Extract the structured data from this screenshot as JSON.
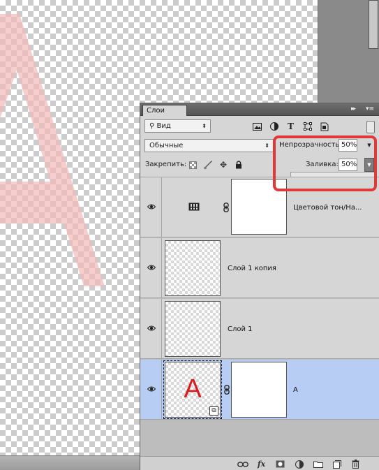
{
  "panel": {
    "tab_label": "Слои",
    "collapse_label": "▸▸",
    "menu_label": "▾≡"
  },
  "filter": {
    "kind_label": "Вид",
    "icons": [
      "image-filter-icon",
      "adjustment-filter-icon",
      "text-filter-icon",
      "shape-filter-icon",
      "smart-object-filter-icon"
    ],
    "text_filter_glyph": "T"
  },
  "blend": {
    "mode": "Обычные",
    "opacity_label": "Непрозрачность:",
    "opacity_value": "50%"
  },
  "lock": {
    "label": "Закрепить:",
    "icons": [
      "lock-transparent-pixels-icon",
      "lock-image-pixels-icon",
      "lock-position-icon",
      "lock-all-icon"
    ]
  },
  "fill": {
    "label": "Заливка:",
    "value": "50%",
    "slider_fraction": 0.5
  },
  "layers": [
    {
      "name": "Цветовой тон/На...",
      "type": "adjustment",
      "visible": true,
      "selected": false
    },
    {
      "name": "Слой 1 копия",
      "type": "pixel",
      "visible": true,
      "selected": false
    },
    {
      "name": "Слой 1",
      "type": "pixel",
      "visible": true,
      "selected": false
    },
    {
      "name": "A",
      "type": "smart-object-with-mask",
      "visible": true,
      "selected": true,
      "thumbnail_letter": "A"
    }
  ],
  "footer": {
    "fx_label": "fx",
    "icons": [
      "link-layers-icon",
      "fx-icon",
      "add-mask-icon",
      "new-adjustment-icon",
      "new-group-icon",
      "new-layer-icon",
      "delete-layer-icon"
    ]
  },
  "colors": {
    "highlight": "#e0393a",
    "selected_row": "#b8cdf4",
    "canvas_letter": "#f4c6c6"
  }
}
